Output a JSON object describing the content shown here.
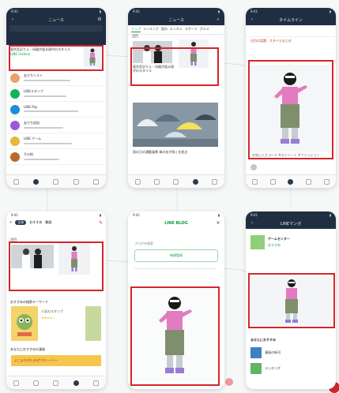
{
  "phones": {
    "p1": {
      "status": "9:41",
      "title": "ニュース",
      "feature_line1": "東京宮沢りえ・母親が語る現代のスタイル",
      "feature_line2": "LINE Fashion",
      "list": [
        {
          "name": "友だちリスト",
          "color": "#e8a36a"
        },
        {
          "name": "LINEスタンプ",
          "color": "#13b255"
        },
        {
          "name": "LINE Pay",
          "color": "#1f8dd6"
        },
        {
          "name": "友だち追加",
          "color": "#9b58d8"
        },
        {
          "name": "LINE ゲーム",
          "color": "#e9b63e"
        },
        {
          "name": "その他",
          "color": "#b9692b"
        }
      ]
    },
    "p2": {
      "status": "9:41",
      "title": "ニュース",
      "tabs": [
        "トップ",
        "ランキング",
        "国内",
        "エンタメ",
        "スポーツ",
        "グルメ"
      ],
      "section": "注目",
      "caption1": "東京宮沢りえ・母親が語る現代のスタイル",
      "caption2": "雨の日の通勤風景 傘の花が咲く交差点"
    },
    "p3": {
      "status": "9:41",
      "title": "タイムライン",
      "post_line": "注目の話題 · スタイルまとめ",
      "caption": "お気に入りコーデ #ストリート #ファッション"
    },
    "p4": {
      "status": "9:41",
      "section": "注目",
      "tabs": [
        "全体",
        "おすすめ",
        "動画"
      ],
      "recommend_title": "おすすめの検索キーワード",
      "recommend_sub": "人気のスタンプ",
      "bottom_title": "あなたにおすすめの漫画",
      "banner": "よこまちがえるぜ!!ストーリー"
    },
    "p5": {
      "status": "9:41",
      "brand": "LINE BLOG",
      "field_label": "ブログを検索",
      "button": "新規登録"
    },
    "p6": {
      "status": "9:41",
      "title": "LINEマンガ",
      "item1": "ゲームセンター",
      "item2": "おすすめ",
      "section": "あなたにおすすめ",
      "entry1": "漫画の新刊",
      "entry2": "ランキング"
    }
  },
  "colors": {
    "highlight": "#d4262a",
    "line_green": "#0b9e3c",
    "dark_header": "#1f2e41"
  }
}
